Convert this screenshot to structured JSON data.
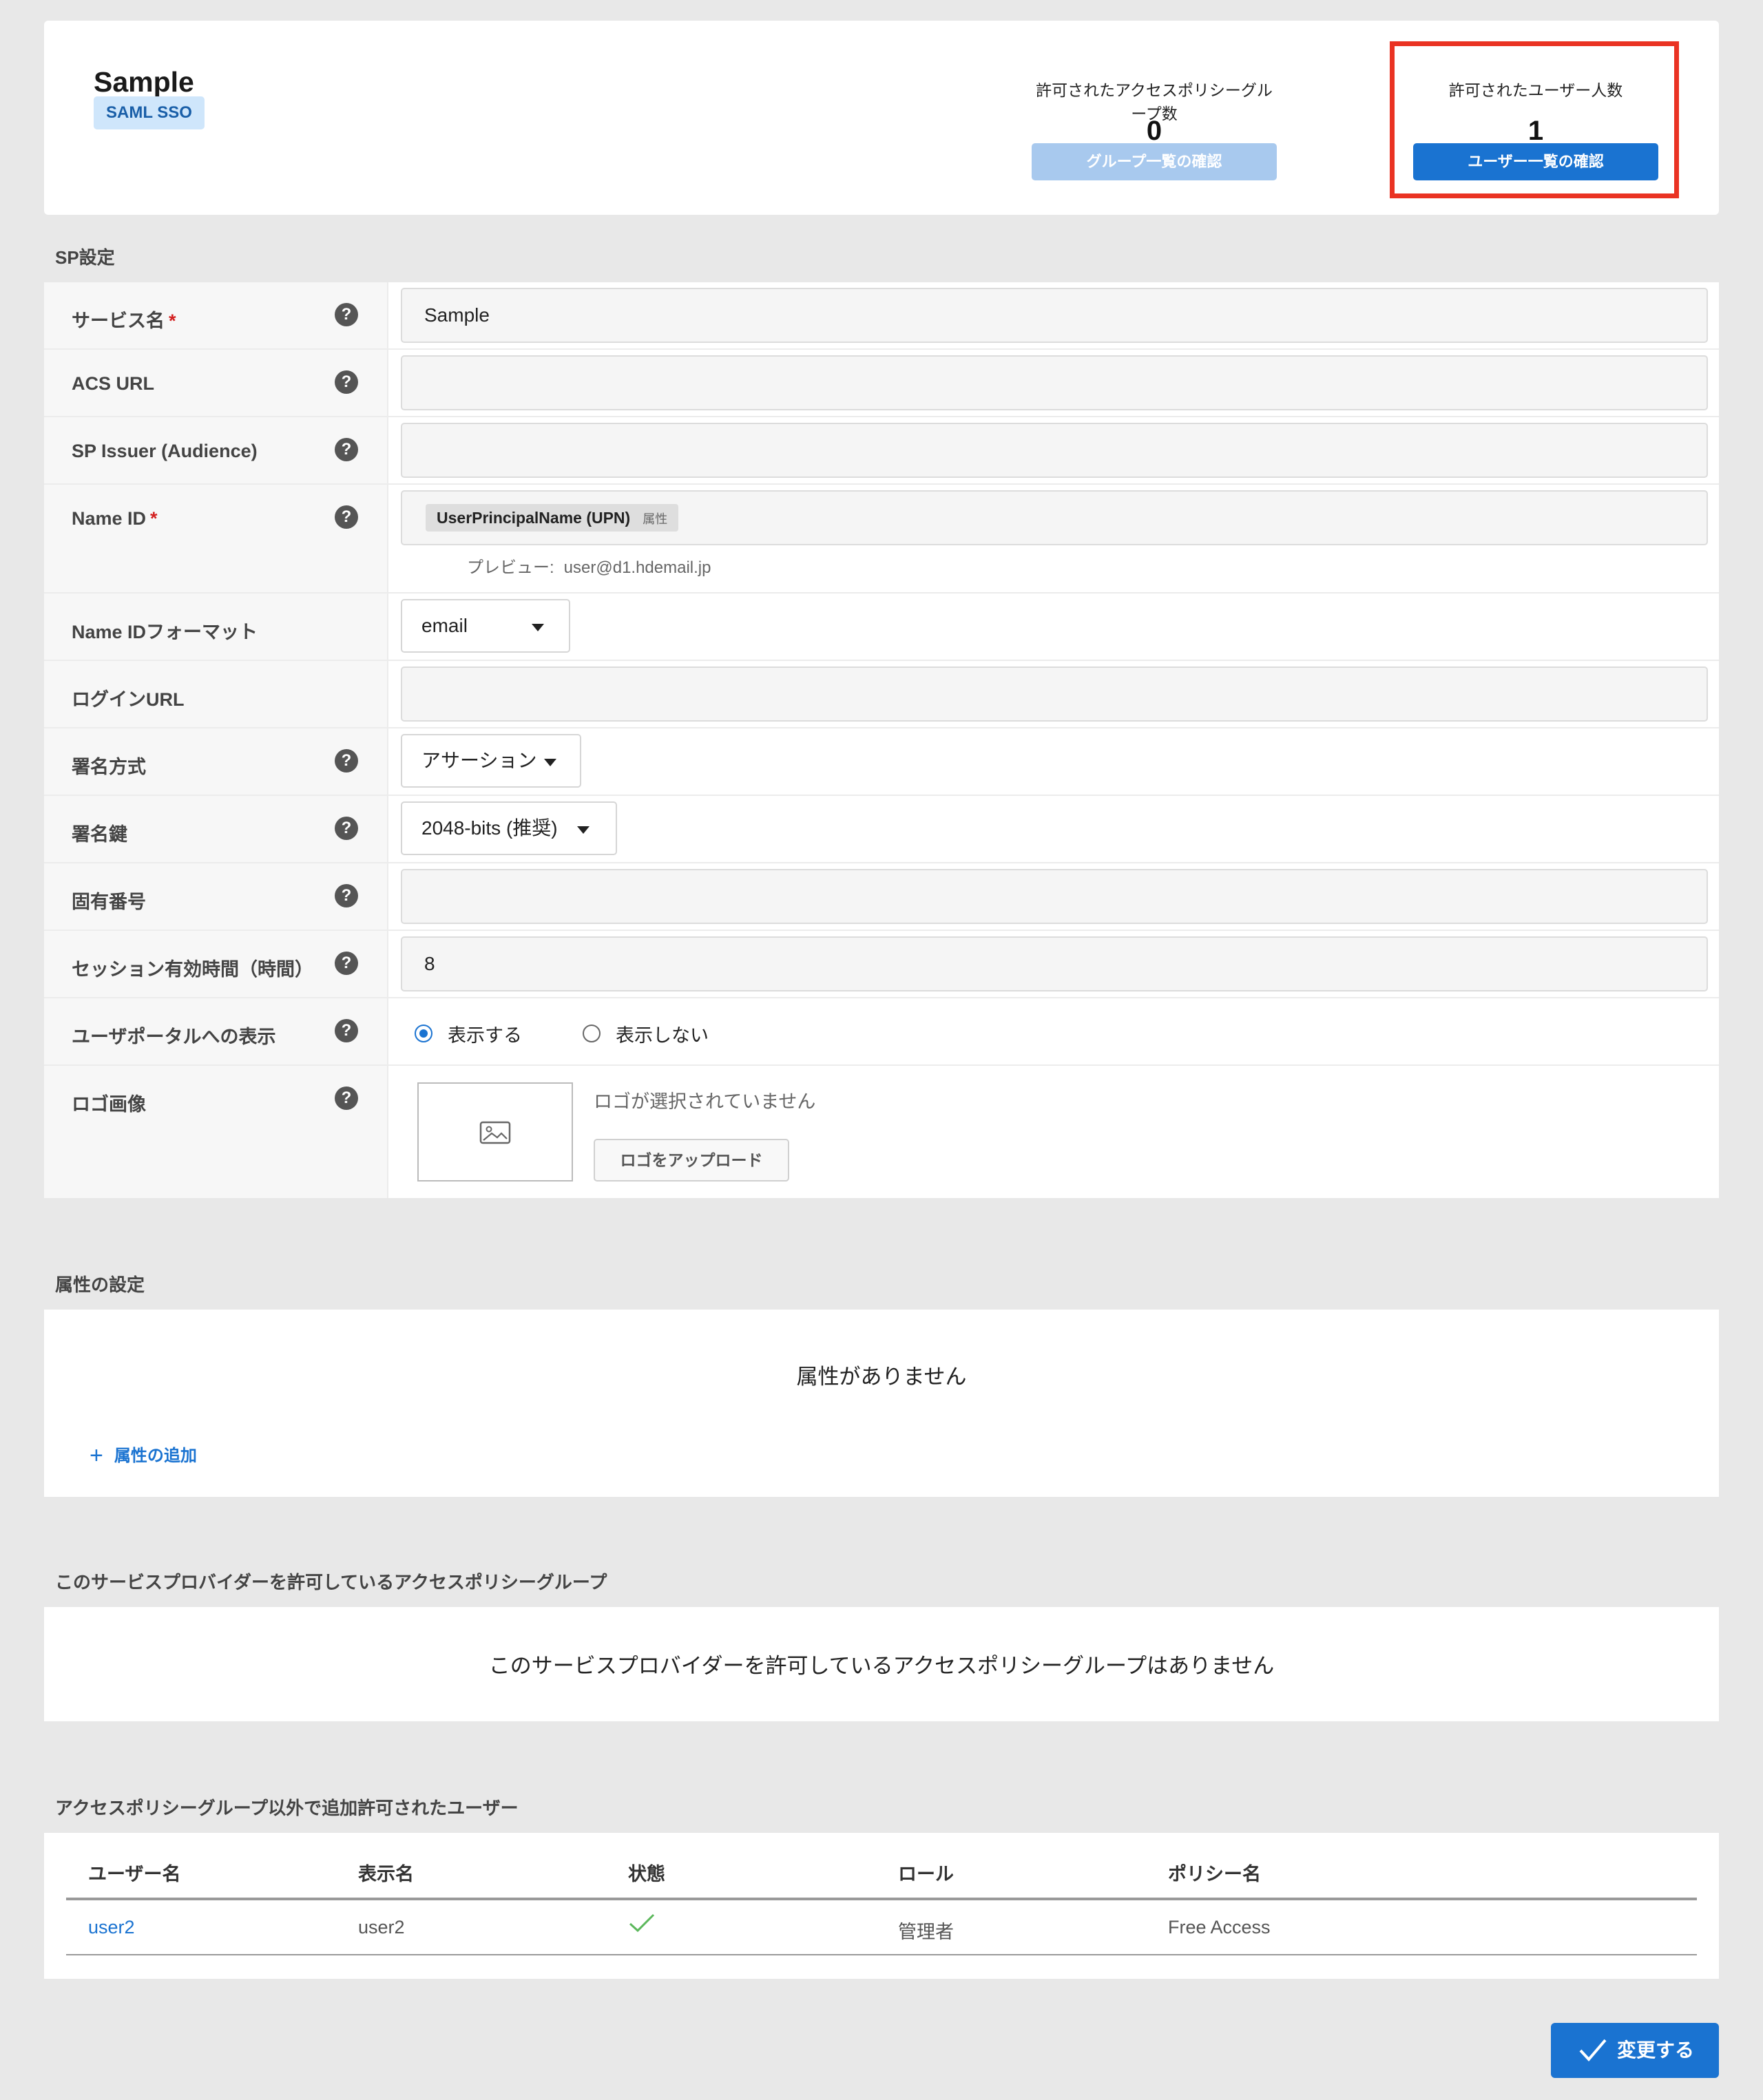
{
  "header": {
    "title": "Sample",
    "badge": "SAML SSO",
    "group_stat": {
      "label": "許可されたアクセスポリシーグループ数",
      "value": "0",
      "button": "グループ一覧の確認"
    },
    "user_stat": {
      "label": "許可されたユーザー人数",
      "value": "1",
      "button": "ユーザー一覧の確認"
    },
    "highlight_color": "#ea3323"
  },
  "sp_settings": {
    "section_title": "SP設定",
    "service_name": {
      "label": "サービス名",
      "required": "*",
      "value": "Sample"
    },
    "acs_url": {
      "label": "ACS URL",
      "value": ""
    },
    "sp_issuer": {
      "label": "SP Issuer (Audience)",
      "value": ""
    },
    "name_id": {
      "label": "Name ID",
      "required": "*",
      "chip": "UserPrincipalName (UPN)",
      "chip_suffix": "属性",
      "preview_label": "プレビュー:",
      "preview_value": "user@d1.hdemail.jp"
    },
    "name_id_format": {
      "label": "Name IDフォーマット",
      "value": "email"
    },
    "login_url": {
      "label": "ログインURL",
      "value": ""
    },
    "sign_method": {
      "label": "署名方式",
      "value": "アサーション"
    },
    "sign_key": {
      "label": "署名鍵",
      "value": "2048-bits (推奨)"
    },
    "unique_number": {
      "label": "固有番号",
      "value": ""
    },
    "session_time": {
      "label": "セッション有効時間（時間）",
      "value": "8"
    },
    "portal_display": {
      "label": "ユーザポータルへの表示",
      "option_show": "表示する",
      "option_hide": "表示しない",
      "selected": "表示する"
    },
    "logo": {
      "label": "ロゴ画像",
      "no_logo": "ロゴが選択されていません",
      "upload_button": "ロゴをアップロード"
    }
  },
  "attributes": {
    "section_title": "属性の設定",
    "empty": "属性がありません",
    "add_link": "属性の追加"
  },
  "policy_groups": {
    "section_title": "このサービスプロバイダーを許可しているアクセスポリシーグループ",
    "empty": "このサービスプロバイダーを許可しているアクセスポリシーグループはありません"
  },
  "extra_users": {
    "section_title": "アクセスポリシーグループ以外で追加許可されたユーザー",
    "columns": [
      "ユーザー名",
      "表示名",
      "状態",
      "ロール",
      "ポリシー名"
    ],
    "rows": [
      {
        "username": "user2",
        "display_name": "user2",
        "status_icon": "check-icon",
        "role": "管理者",
        "policy": "Free Access"
      }
    ]
  },
  "footer": {
    "save_button": "変更する"
  },
  "colors": {
    "accent": "#1a73d1",
    "check": "#5cb85c"
  }
}
